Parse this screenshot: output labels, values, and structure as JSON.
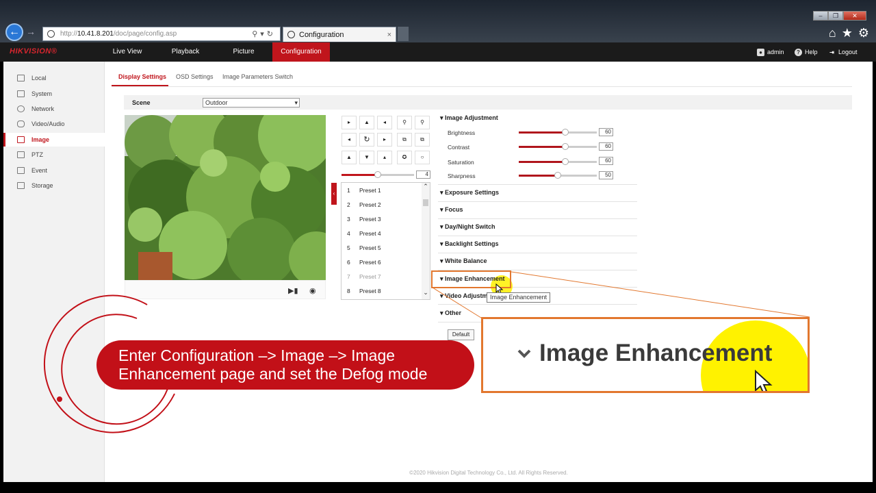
{
  "browser": {
    "url_prefix": "http://",
    "url_host": "10.41.8.201",
    "url_path": "/doc/page/config.asp",
    "tab_title": "Configuration",
    "tab_close": "×"
  },
  "app": {
    "logo": "HIKVISION®",
    "nav": [
      "Live View",
      "Playback",
      "Picture",
      "Configuration"
    ],
    "user": "admin",
    "help": "Help",
    "logout": "Logout"
  },
  "sidebar": {
    "items": [
      "Local",
      "System",
      "Network",
      "Video/Audio",
      "Image",
      "PTZ",
      "Event",
      "Storage"
    ],
    "active": "Image"
  },
  "subtabs": [
    "Display Settings",
    "OSD Settings",
    "Image Parameters Switch"
  ],
  "scene": {
    "label": "Scene",
    "value": "Outdoor"
  },
  "ptz": {
    "speed": "4",
    "speed_fraction": 0.5,
    "presets": [
      {
        "num": "1",
        "name": "Preset 1"
      },
      {
        "num": "2",
        "name": "Preset 2"
      },
      {
        "num": "3",
        "name": "Preset 3"
      },
      {
        "num": "4",
        "name": "Preset 4"
      },
      {
        "num": "5",
        "name": "Preset 5"
      },
      {
        "num": "6",
        "name": "Preset 6"
      },
      {
        "num": "7",
        "name": "Preset 7"
      },
      {
        "num": "8",
        "name": "Preset 8"
      }
    ]
  },
  "image_adjustment": {
    "title": "Image Adjustment",
    "items": [
      {
        "label": "Brightness",
        "value": "60"
      },
      {
        "label": "Contrast",
        "value": "60"
      },
      {
        "label": "Saturation",
        "value": "60"
      },
      {
        "label": "Sharpness",
        "value": "50"
      }
    ]
  },
  "sections": [
    "Exposure Settings",
    "Focus",
    "Day/Night Switch",
    "Backlight Settings",
    "White Balance",
    "Image Enhancement",
    "Video Adjustm",
    "Other"
  ],
  "tooltip": "Image Enhancement",
  "default_button": "Default",
  "callout_text": "Image Enhancement",
  "banner": {
    "line1": "Enter Configuration –> Image –> Image",
    "line2": "Enhancement page and set the Defog mode"
  },
  "footer": "©2020 Hikvision Digital Technology Co., Ltd. All Rights Reserved.",
  "colors": {
    "accent": "#c0151c",
    "highlight": "#e2772e",
    "cursor_glow": "#fff200"
  }
}
